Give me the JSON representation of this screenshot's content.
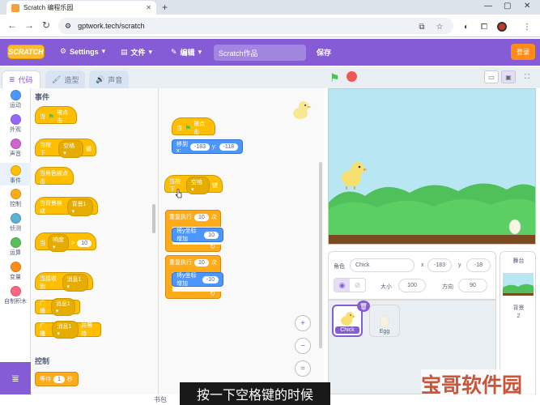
{
  "browser": {
    "tab_title": "Scratch 编程乐园",
    "url": "gptwork.tech/scratch"
  },
  "menu": {
    "logo_text": "SCRATCH",
    "settings": "Settings",
    "file": "文件",
    "edit": "编辑",
    "project_title": "Scratch作品",
    "save": "保存",
    "login": "登录"
  },
  "editor_tabs": {
    "code": "代码",
    "costumes": "造型",
    "sounds": "声音"
  },
  "categories": [
    {
      "label": "运动",
      "color": "#4c97ff"
    },
    {
      "label": "外观",
      "color": "#9966ff"
    },
    {
      "label": "声音",
      "color": "#cf63cf"
    },
    {
      "label": "事件",
      "color": "#ffbf00"
    },
    {
      "label": "控制",
      "color": "#ffab19"
    },
    {
      "label": "侦测",
      "color": "#5cb1d6"
    },
    {
      "label": "运算",
      "color": "#59c059"
    },
    {
      "label": "变量",
      "color": "#ff8c1a"
    },
    {
      "label": "自制积木",
      "color": "#ff6680"
    }
  ],
  "palette": {
    "events_header": "事件",
    "when_flag_prefix": "当",
    "when_flag_suffix": "被点击",
    "when_key_prefix": "当按下",
    "when_key_value": "空格",
    "when_key_suffix": "键",
    "when_sprite_clicked": "当角色被点击",
    "when_backdrop_prefix": "当背景换成",
    "when_backdrop_value": "背景1",
    "when_gt_prefix": "当",
    "when_gt_value": "响度",
    "when_gt_sign": ">",
    "when_gt_num": "10",
    "when_receive_prefix": "当接收到",
    "when_receive_value": "消息1",
    "broadcast_prefix": "广播",
    "broadcast_value": "消息1",
    "broadcast_wait_suffix": "并等待",
    "control_header": "控制",
    "wait_prefix": "等待",
    "wait_num": "1",
    "wait_suffix": "秒"
  },
  "script": {
    "flag_prefix": "当",
    "flag_suffix": "被点击",
    "goto_prefix": "移到 x:",
    "goto_x": "-183",
    "goto_y_label": "y:",
    "goto_y": "-118",
    "key_prefix": "当按下",
    "key_value": "空格",
    "key_suffix": "键",
    "repeat1_prefix": "重复执行",
    "repeat1_num": "10",
    "repeat1_suffix": "次",
    "change1_prefix": "将y坐标增加",
    "change1_num": "10",
    "repeat2_prefix": "重复执行",
    "repeat2_num": "10",
    "repeat2_suffix": "次",
    "change2_prefix": "将y坐标增加",
    "change2_num": "-10",
    "loop_arrow": "↻"
  },
  "zoom": {
    "in": "+",
    "out": "−",
    "reset": "="
  },
  "sprite_info": {
    "sprite_label": "角色",
    "sprite_name": "Chick",
    "x_label": "x",
    "x": "-183",
    "y_label": "y",
    "y": "-18",
    "show_label": "显示",
    "size_label": "大小",
    "size": "100",
    "direction_label": "方向",
    "direction": "90"
  },
  "sprites": [
    {
      "name": "Chick",
      "selected": true
    },
    {
      "name": "Egg",
      "selected": false
    }
  ],
  "stage_panel": {
    "title": "舞台",
    "backdrop_label": "背景",
    "backdrop_count": "2"
  },
  "caption": "按一下空格键的时候",
  "watermark": "宝哥软件园",
  "backpack": "书包"
}
